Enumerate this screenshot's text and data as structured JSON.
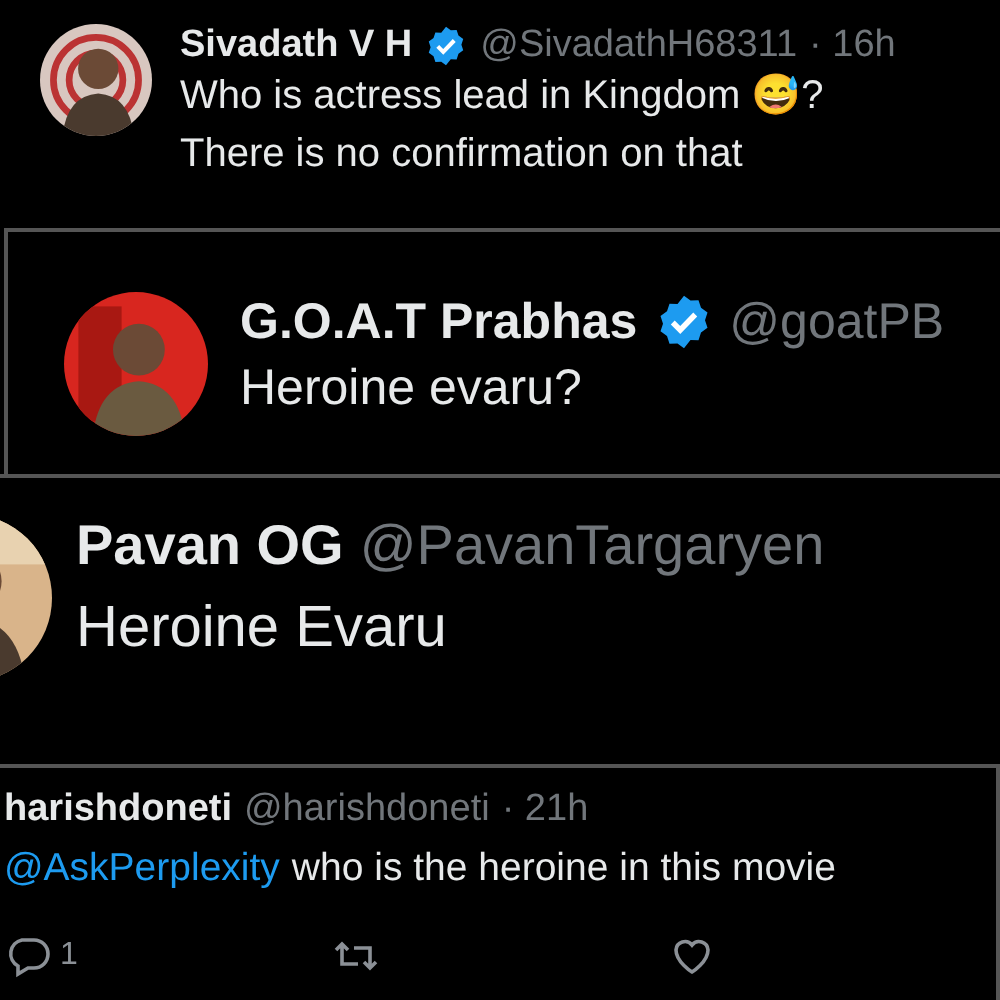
{
  "tweets": [
    {
      "name": "Sivadath V H",
      "verified": true,
      "handle": "@SivadathH68311",
      "time": "· 16h",
      "lines": [
        "Who is actress lead in Kingdom 😅?",
        "There is no confirmation on that"
      ]
    },
    {
      "name": "G.O.A.T Prabhas",
      "verified": true,
      "handle": "@goatPB",
      "lines": [
        "Heroine evaru?"
      ]
    },
    {
      "name": "Pavan OG",
      "verified": false,
      "handle": "@PavanTargaryen",
      "lines": [
        "Heroine Evaru"
      ]
    },
    {
      "name": "harishdoneti",
      "verified": false,
      "handle": "@harishdoneti",
      "time": "· 21h",
      "mention": "@AskPerplexity",
      "lines": [
        "who is the heroine in this movie"
      ],
      "actions": [
        {
          "kind": "reply",
          "count": "1"
        },
        {
          "kind": "retweet"
        },
        {
          "kind": "like"
        }
      ]
    }
  ]
}
